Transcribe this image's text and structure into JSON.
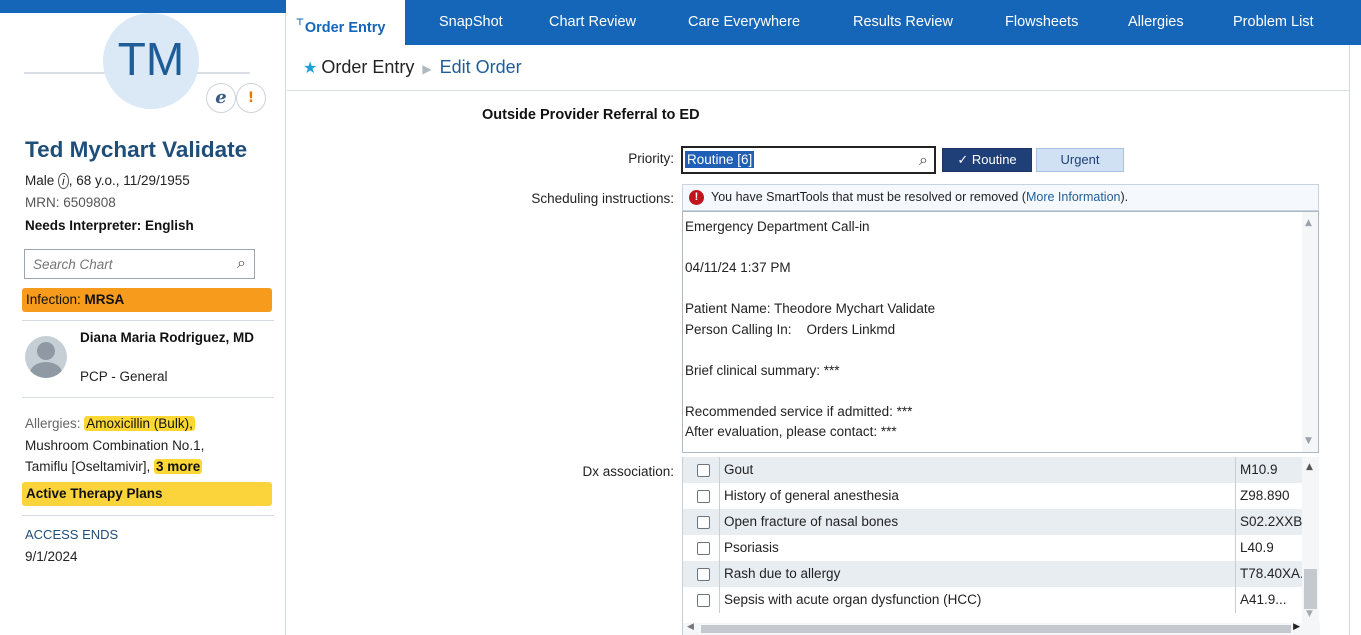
{
  "tabs": [
    {
      "label": "Order Entry",
      "active": true
    },
    {
      "label": "SnapShot"
    },
    {
      "label": "Chart Review"
    },
    {
      "label": "Care Everywhere"
    },
    {
      "label": "Results Review"
    },
    {
      "label": "Flowsheets"
    },
    {
      "label": "Allergies"
    },
    {
      "label": "Problem List"
    }
  ],
  "patient": {
    "initials": "TM",
    "name": "Ted Mychart Validate",
    "sex": "Male",
    "info_icon": "info-icon",
    "age_dob": ", 68 y.o., 11/29/1955",
    "mrn": "MRN: 6509808",
    "interpreter": "Needs Interpreter: English",
    "infection_label": "Infection: ",
    "infection_value": "MRSA"
  },
  "search": {
    "placeholder": "Search Chart"
  },
  "pcp": {
    "name": "Diana Maria Rodriguez, MD",
    "role": "PCP - General"
  },
  "allergies": {
    "label": "Allergies:",
    "item1": "Amoxicillin (Bulk),",
    "item2": "Mushroom Combination No.1,",
    "item3": "Tamiflu [Oseltamivir],",
    "more": "3 more"
  },
  "therapy": "Active Therapy Plans",
  "access": {
    "label": "ACCESS ENDS",
    "date": "9/1/2024"
  },
  "breadcrumb": {
    "root": "Order Entry",
    "current": "Edit Order"
  },
  "order": {
    "title": "Outside Provider Referral to ED",
    "priority_label": "Priority:",
    "priority_value": "Routine [6]",
    "routine_label": "✓ Routine",
    "urgent_label": "Urgent",
    "sched_label": "Scheduling instructions:",
    "smart_msg": "You have SmartTools that must be resolved or removed (",
    "smart_link": "More Information",
    "smart_end": ").",
    "sched_text": "Emergency Department Call-in\n\n04/11/24 1:37 PM\n\nPatient Name: Theodore Mychart Validate\nPerson Calling In:    Orders Linkmd\n\nBrief clinical summary: ***\n\nRecommended service if admitted: ***\nAfter evaluation, please contact: ***",
    "dx_label": "Dx association:"
  },
  "dx_rows": [
    {
      "name": "Gout",
      "code": "M10.9"
    },
    {
      "name": "History of general anesthesia",
      "code": "Z98.890"
    },
    {
      "name": "Open fracture of nasal bones",
      "code": "S02.2XXB"
    },
    {
      "name": "Psoriasis",
      "code": "L40.9"
    },
    {
      "name": "Rash due to allergy",
      "code": "T78.40XA..."
    },
    {
      "name": "Sepsis with acute organ dysfunction (HCC)",
      "code": "A41.9..."
    }
  ],
  "colors": {
    "tabbar": "#1565b8",
    "infection": "#f79b1d",
    "highlight": "#fdd835",
    "routine_btn": "#1f3f79"
  }
}
